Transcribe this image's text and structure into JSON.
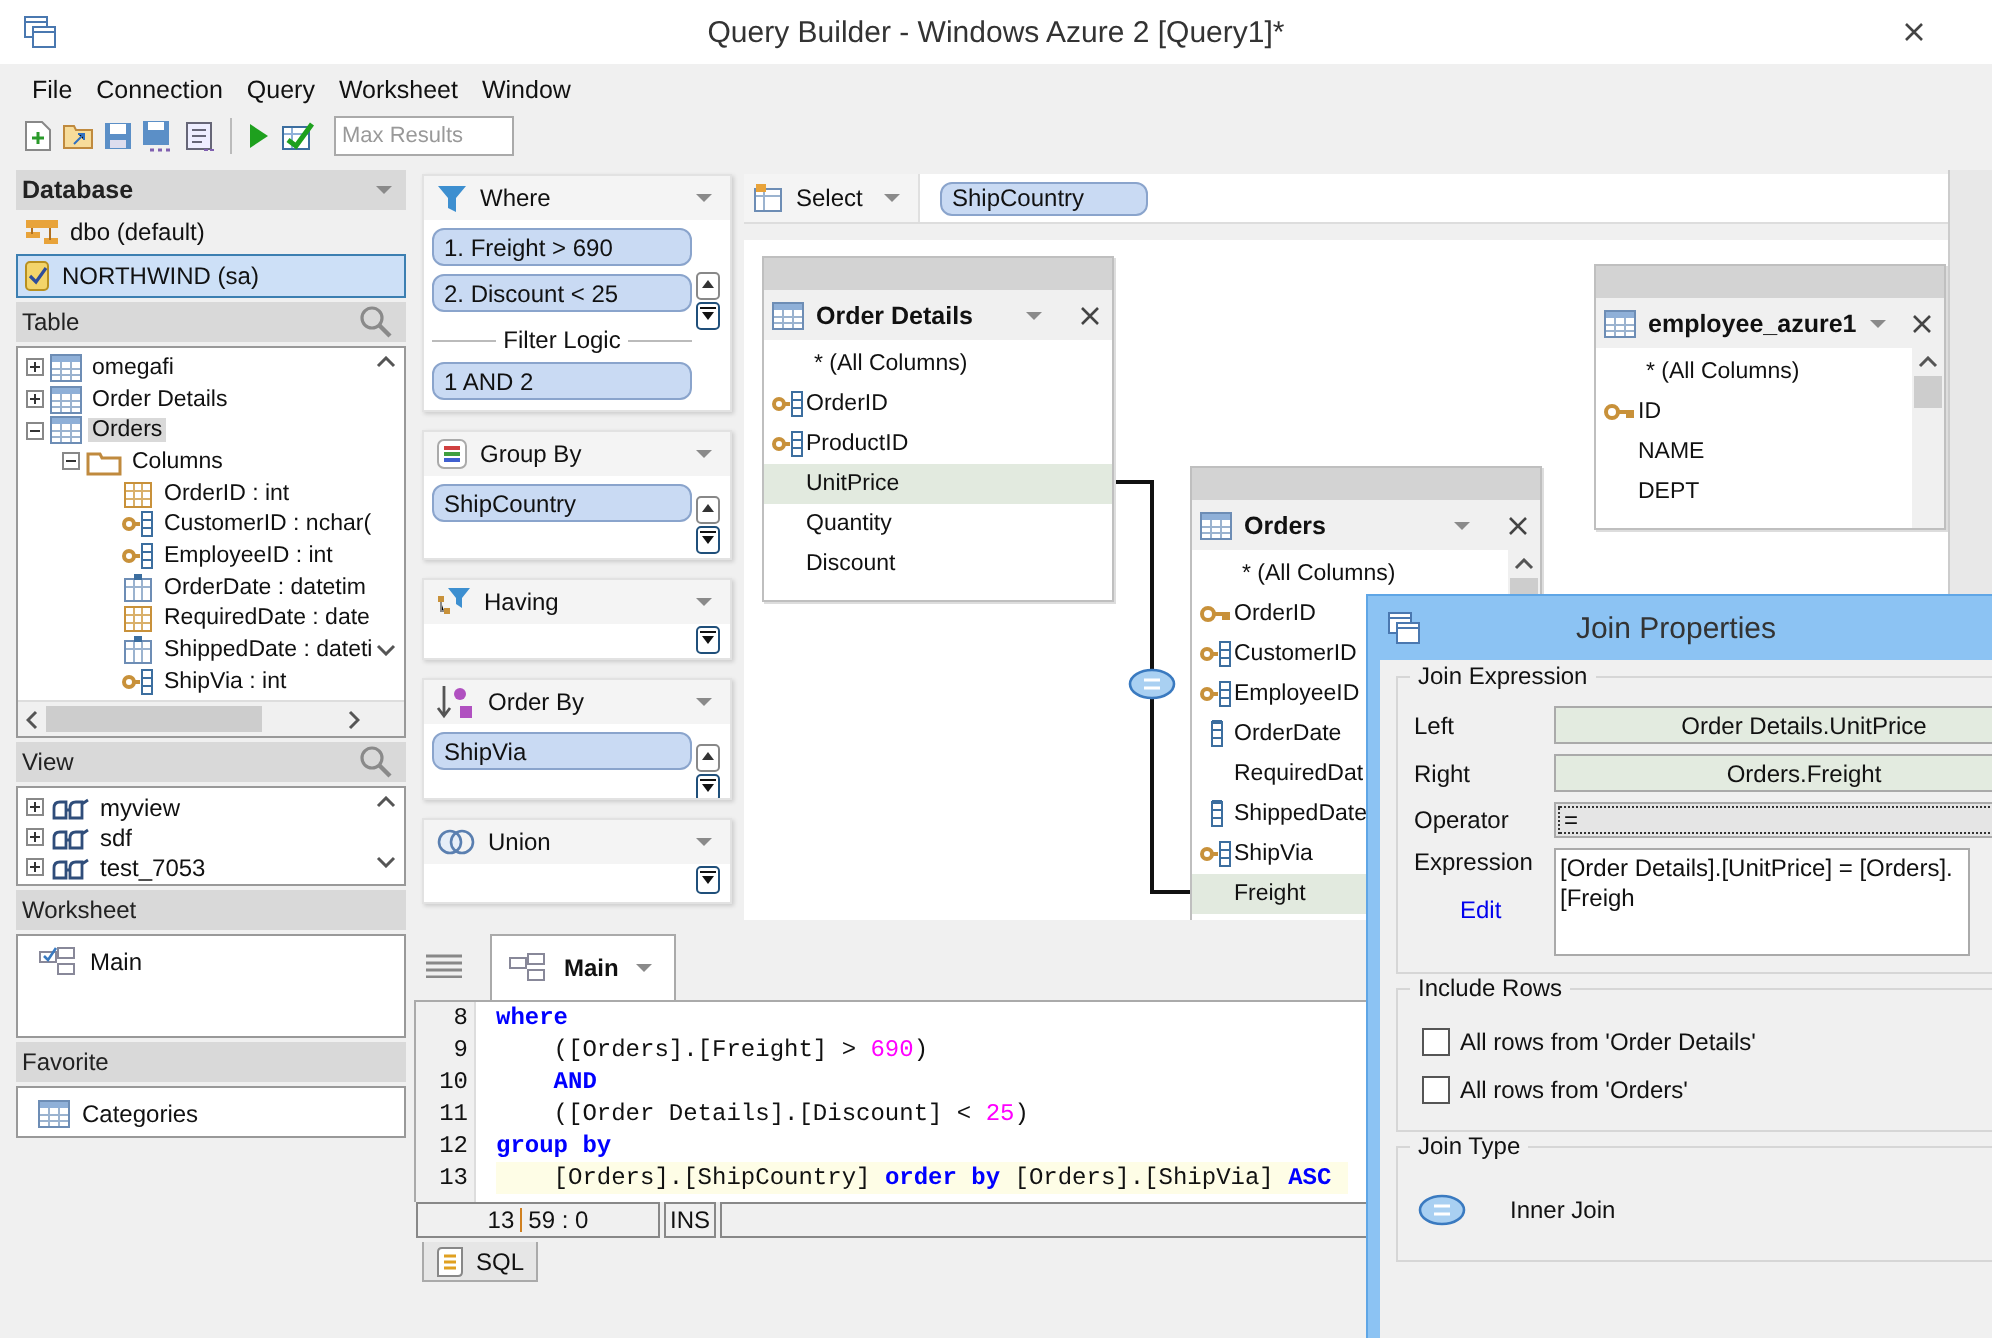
{
  "window": {
    "title": "Query Builder - Windows Azure 2 [Query1]*"
  },
  "menu": [
    "File",
    "Connection",
    "Query",
    "Worksheet",
    "Window"
  ],
  "toolbar": {
    "max_results": {
      "placeholder": "Max Results"
    }
  },
  "database_panel": {
    "title": "Database",
    "items": [
      {
        "label": "dbo (default)",
        "kind": "schema",
        "selected": false
      },
      {
        "label": "NORTHWIND (sa)",
        "kind": "database",
        "selected": true
      }
    ]
  },
  "table_panel": {
    "title": "Table",
    "tree": [
      {
        "label": "omegafi",
        "kind": "table",
        "expanded": false,
        "selected": false
      },
      {
        "label": "Order Details",
        "kind": "table",
        "expanded": false,
        "selected": false
      },
      {
        "label": "Orders",
        "kind": "table",
        "expanded": true,
        "selected": true,
        "children": [
          {
            "label": "Columns",
            "kind": "folder",
            "expanded": true,
            "selected": false,
            "children": [
              {
                "label": "OrderID : int",
                "kind": "primary_key",
                "selected": false
              },
              {
                "label": "CustomerID : nchar(",
                "kind": "foreign_key",
                "selected": false
              },
              {
                "label": "EmployeeID : int",
                "kind": "foreign_key",
                "selected": false
              },
              {
                "label": "OrderDate : datetim",
                "kind": "date",
                "selected": false
              },
              {
                "label": "RequiredDate : date",
                "kind": "column",
                "selected": false
              },
              {
                "label": "ShippedDate : dateti",
                "kind": "date",
                "selected": false
              },
              {
                "label": "ShipVia : int",
                "kind": "foreign_key",
                "selected": false
              }
            ]
          }
        ]
      }
    ]
  },
  "view_panel": {
    "title": "View",
    "items": [
      {
        "label": "myview",
        "expanded": false
      },
      {
        "label": "sdf",
        "expanded": false
      },
      {
        "label": "test_7053",
        "expanded": false
      }
    ]
  },
  "worksheet_panel": {
    "title": "Worksheet",
    "items": [
      "Main"
    ]
  },
  "favorite_panel": {
    "title": "Favorite",
    "items": [
      "Categories"
    ]
  },
  "clauses": [
    {
      "kind": "where",
      "title": "Where",
      "items": [
        "1. Freight > 690",
        "2. Discount < 25"
      ],
      "filter_logic": {
        "label": "Filter Logic",
        "value": "1 AND 2"
      }
    },
    {
      "kind": "group_by",
      "title": "Group By",
      "items": [
        "ShipCountry"
      ]
    },
    {
      "kind": "having",
      "title": "Having"
    },
    {
      "kind": "order_by",
      "title": "Order By",
      "items": [
        "ShipVia"
      ]
    },
    {
      "kind": "union",
      "title": "Union"
    }
  ],
  "select": {
    "label": "Select",
    "items": [
      "ShipCountry"
    ]
  },
  "diagram": {
    "tables": [
      {
        "name": "Order Details",
        "columns": [
          {
            "name": "* (All Columns)",
            "kind": "all",
            "highlighted": false
          },
          {
            "name": "OrderID",
            "kind": "foreign_key",
            "highlighted": false
          },
          {
            "name": "ProductID",
            "kind": "foreign_key",
            "highlighted": false
          },
          {
            "name": "UnitPrice",
            "kind": "plain",
            "highlighted": true
          },
          {
            "name": "Quantity",
            "kind": "plain",
            "highlighted": false
          },
          {
            "name": "Discount",
            "kind": "plain",
            "highlighted": false
          }
        ]
      },
      {
        "name": "Orders",
        "columns": [
          {
            "name": "* (All Columns)",
            "kind": "all",
            "highlighted": false
          },
          {
            "name": "OrderID",
            "kind": "primary_key",
            "highlighted": false
          },
          {
            "name": "CustomerID",
            "kind": "foreign_key",
            "highlighted": false
          },
          {
            "name": "EmployeeID",
            "kind": "foreign_key",
            "highlighted": false
          },
          {
            "name": "OrderDate",
            "kind": "indexed",
            "highlighted": false
          },
          {
            "name": "RequiredDat",
            "kind": "plain",
            "highlighted": false
          },
          {
            "name": "ShippedDate",
            "kind": "indexed",
            "highlighted": false
          },
          {
            "name": "ShipVia",
            "kind": "foreign_key",
            "highlighted": false
          },
          {
            "name": "Freight",
            "kind": "plain",
            "highlighted": true
          }
        ]
      },
      {
        "name": "employee_azure1",
        "columns": [
          {
            "name": "* (All Columns)",
            "kind": "all",
            "highlighted": false
          },
          {
            "name": "ID",
            "kind": "primary_key",
            "highlighted": false
          },
          {
            "name": "NAME",
            "kind": "plain",
            "highlighted": false
          },
          {
            "name": "DEPT",
            "kind": "plain",
            "highlighted": false
          }
        ]
      }
    ]
  },
  "editor": {
    "tabs": [
      {
        "label": "Main",
        "selected": true
      }
    ],
    "lines": [
      {
        "number": "8",
        "current": false,
        "indented": false,
        "tokens": [
          {
            "kind": "keyword",
            "text": "where"
          }
        ]
      },
      {
        "number": "9",
        "current": false,
        "indented": true,
        "tokens": [
          {
            "kind": "plain",
            "text": "([Orders].[Freight] > "
          },
          {
            "kind": "number",
            "text": "690"
          },
          {
            "kind": "plain",
            "text": ")"
          }
        ]
      },
      {
        "number": "10",
        "current": false,
        "indented": true,
        "tokens": [
          {
            "kind": "keyword",
            "text": "AND"
          }
        ]
      },
      {
        "number": "11",
        "current": false,
        "indented": true,
        "tokens": [
          {
            "kind": "plain",
            "text": "([Order Details].[Discount] < "
          },
          {
            "kind": "number",
            "text": "25"
          },
          {
            "kind": "plain",
            "text": ")"
          }
        ]
      },
      {
        "number": "12",
        "current": false,
        "indented": false,
        "tokens": [
          {
            "kind": "keyword",
            "text": "group by"
          }
        ]
      },
      {
        "number": "13",
        "current": true,
        "indented": true,
        "tokens": [
          {
            "kind": "plain",
            "text": "[Orders].[ShipCountry] "
          },
          {
            "kind": "keyword",
            "text": "order by"
          },
          {
            "kind": "plain",
            "text": " [Orders].[ShipVia] "
          },
          {
            "kind": "keyword",
            "text": "ASC"
          }
        ]
      }
    ],
    "status": {
      "line": "13",
      "position": "59 : 0",
      "mode": "INS"
    },
    "bottom_tabs": [
      {
        "label": "SQL",
        "selected": true
      }
    ]
  },
  "join_dialog": {
    "title": "Join Properties",
    "expression_group": {
      "title": "Join Expression",
      "left_label": "Left",
      "left": "Order Details.UnitPrice",
      "right_label": "Right",
      "right": "Orders.Freight",
      "operator_label": "Operator",
      "operator": "=",
      "expression_label": "Expression",
      "expression": "[Order Details].[UnitPrice] = [Orders].[Freigh",
      "edit_link": "Edit"
    },
    "include_rows": {
      "title": "Include Rows",
      "options": [
        {
          "label": "All rows from 'Order Details'",
          "checked": false
        },
        {
          "label": "All rows from 'Orders'",
          "checked": false
        }
      ]
    },
    "join_type": {
      "title": "Join Type",
      "label": "Inner Join"
    }
  }
}
